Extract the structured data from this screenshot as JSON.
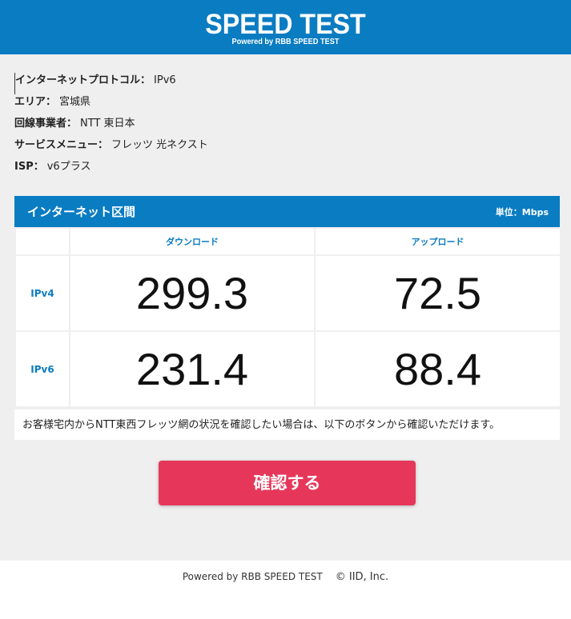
{
  "header": {
    "title": "SPEED TEST",
    "subtitle": "Powered by RBB SPEED TEST"
  },
  "info": [
    {
      "key": "インターネットプロトコル：",
      "value": "IPv6"
    },
    {
      "key": "エリア：",
      "value": "宮城県"
    },
    {
      "key": "回線事業者：",
      "value": "NTT 東日本"
    },
    {
      "key": "サービスメニュー：",
      "value": "フレッツ 光ネクスト"
    },
    {
      "key": "ISP：",
      "value": "v6プラス"
    }
  ],
  "panel": {
    "title": "インターネット区間",
    "unit": "単位：Mbps",
    "columns": [
      "",
      "ダウンロード",
      "アップロード"
    ],
    "rows": [
      {
        "label": "IPv4",
        "download": "299.3",
        "upload": "72.5"
      },
      {
        "label": "IPv6",
        "download": "231.4",
        "upload": "88.4"
      }
    ],
    "note": "お客様宅内からNTT東西フレッツ網の状況を確認したい場合は、以下のボタンから確認いただけます。"
  },
  "confirm_label": "確認する",
  "footer": {
    "powered": "Powered by RBB SPEED TEST",
    "copyright": "© IID, Inc."
  },
  "colors": {
    "brand_blue": "#0a7cc2",
    "confirm_red": "#e6375a",
    "background": "#efefef"
  }
}
